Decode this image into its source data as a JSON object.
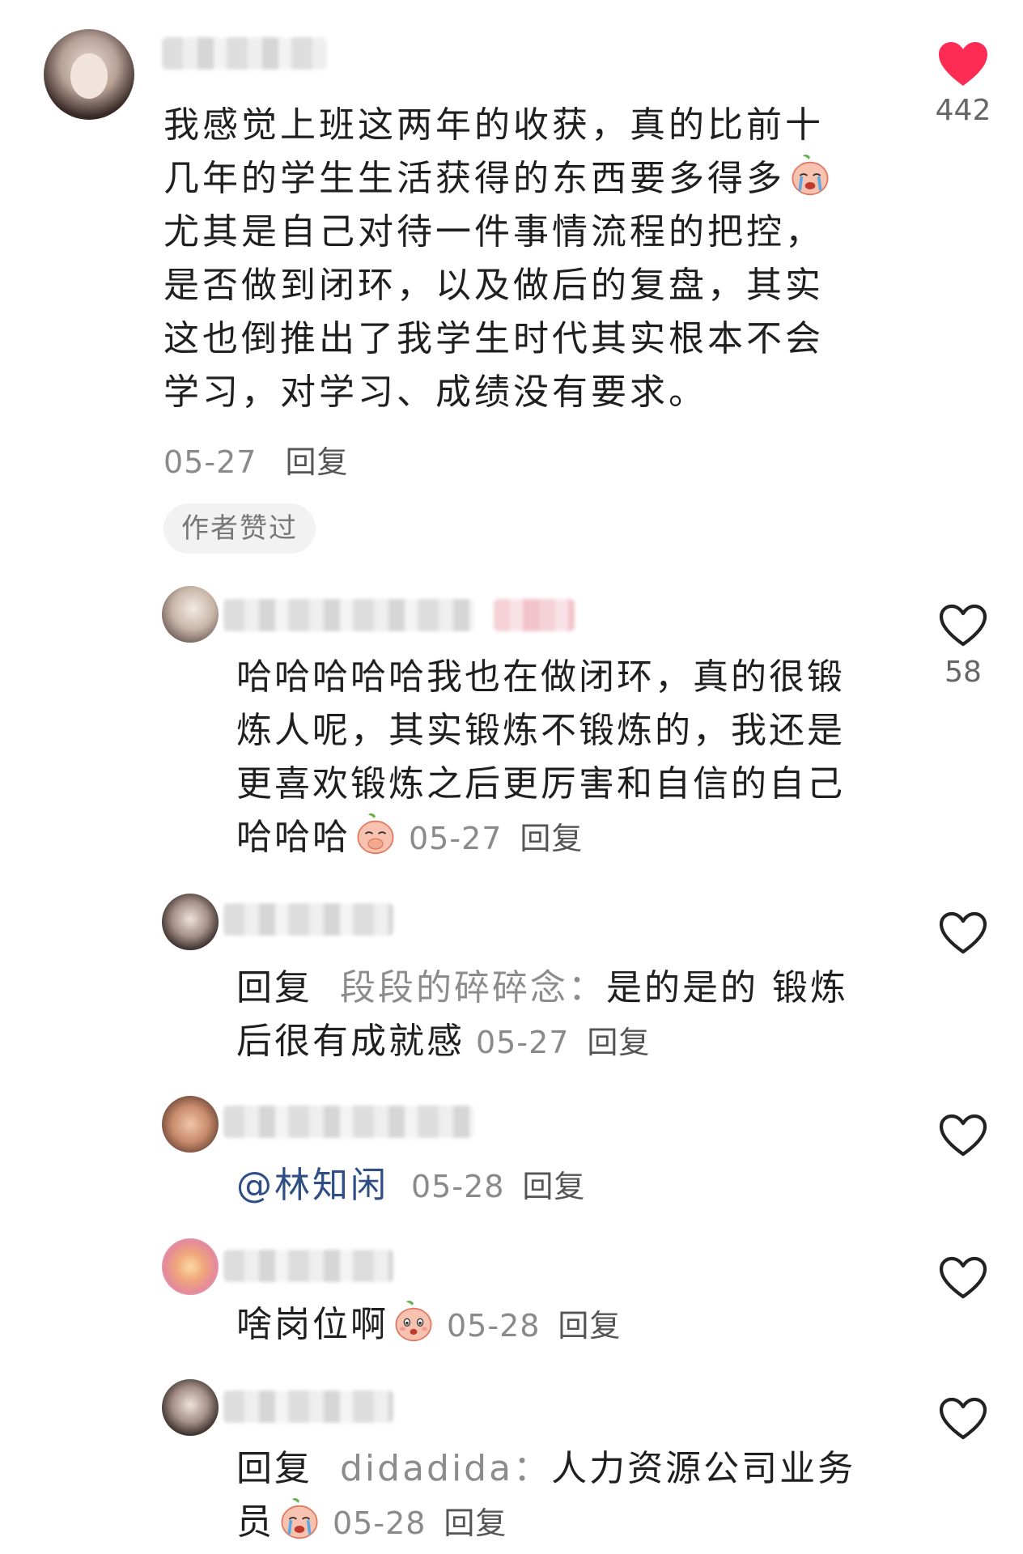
{
  "main_comment": {
    "lines": [
      "我感觉上班这两年的收获，真的比前十",
      "几年的学生生活获得的东西要多得多",
      "尤其是自己对待一件事情流程的把控，",
      "是否做到闭环，以及做后的复盘，其实",
      "这也倒推出了我学生时代其实根本不会",
      "学习，对学习、成绩没有要求。"
    ],
    "date": "05-27",
    "reply_label": "回复",
    "author_liked": "作者赞过",
    "likes": "442",
    "liked": true
  },
  "replies": [
    {
      "lines": [
        "哈哈哈哈哈我也在做闭环，真的很锻",
        "炼人呢，其实锻炼不锻炼的，我还是",
        "更喜欢锻炼之后更厉害和自信的自己",
        "哈哈哈"
      ],
      "date": "05-27",
      "reply_label": "回复",
      "likes": "58"
    },
    {
      "prefix": "回复",
      "target": "段段的碎碎念：",
      "line1_rest": "是的是的 锻炼",
      "line2": "后很有成就感",
      "date": "05-27",
      "reply_label": "回复"
    },
    {
      "mention": "@林知闲",
      "date": "05-28",
      "reply_label": "回复"
    },
    {
      "text": "啥岗位啊",
      "date": "05-28",
      "reply_label": "回复"
    },
    {
      "prefix": "回复",
      "target": "didadida：",
      "line1_rest": "人力资源公司业务",
      "line2": "员",
      "date": "05-28",
      "reply_label": "回复"
    }
  ],
  "colors": {
    "heart_liked": "#fe2c55",
    "heart_outline": "#222222",
    "meta_gray": "#8a8a8a",
    "mention_blue": "#2e4e84"
  }
}
